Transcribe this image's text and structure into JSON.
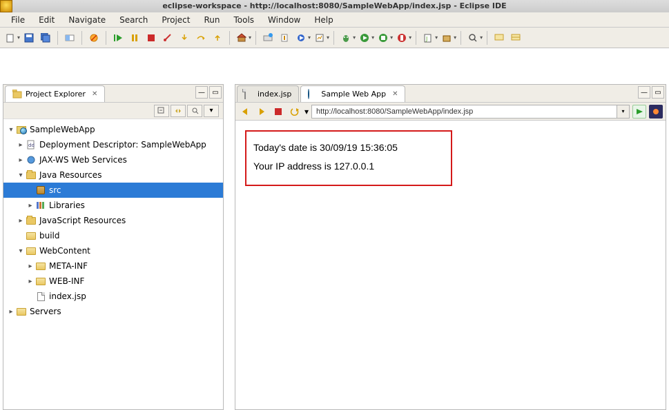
{
  "title": "eclipse-workspace - http://localhost:8080/SampleWebApp/index.jsp - Eclipse IDE",
  "menu": {
    "file": "File",
    "edit": "Edit",
    "navigate": "Navigate",
    "search": "Search",
    "project": "Project",
    "run": "Run",
    "tools": "Tools",
    "window": "Window",
    "help": "Help"
  },
  "explorer": {
    "title": "Project Explorer",
    "tree": {
      "project": "SampleWebApp",
      "dd": "Deployment Descriptor: SampleWebApp",
      "jaxws": "JAX-WS Web Services",
      "javares": "Java Resources",
      "src": "src",
      "libs": "Libraries",
      "jsres": "JavaScript Resources",
      "build": "build",
      "webcontent": "WebContent",
      "metainf": "META-INF",
      "webinf": "WEB-INF",
      "indexjsp": "index.jsp",
      "servers": "Servers"
    }
  },
  "editor": {
    "tab1": "index.jsp",
    "tab2": "Sample Web App",
    "url": "http://localhost:8080/SampleWebApp/index.jsp",
    "content": {
      "line1": "Today's date is 30/09/19 15:36:05",
      "line2": "Your IP address is 127.0.0.1"
    }
  }
}
